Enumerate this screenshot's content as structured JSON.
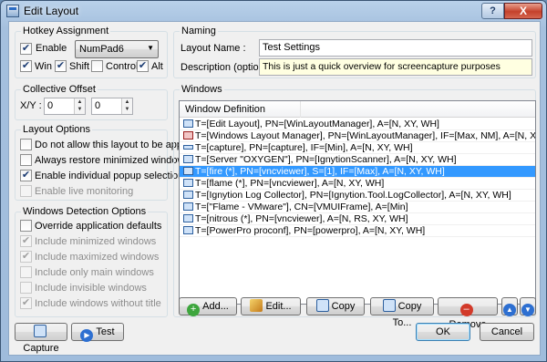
{
  "window": {
    "title": "Edit Layout",
    "help_glyph": "?",
    "close_glyph": "X"
  },
  "hotkey": {
    "group_title": "Hotkey Assignment",
    "enable_label": "Enable",
    "key_value": "NumPad6",
    "modifiers": [
      {
        "label": "Win",
        "checked": true
      },
      {
        "label": "Shift",
        "checked": true
      },
      {
        "label": "Control",
        "checked": false
      },
      {
        "label": "Alt",
        "checked": true
      }
    ]
  },
  "offset": {
    "group_title": "Collective Offset",
    "xy_label": "X/Y :",
    "x_value": "0",
    "y_value": "0"
  },
  "layout_options": {
    "group_title": "Layout Options",
    "items": [
      {
        "label": "Do not allow this layout to be applied",
        "checked": false,
        "enabled": true
      },
      {
        "label": "Always restore minimized windows",
        "checked": false,
        "enabled": true
      },
      {
        "label": "Enable individual popup selection",
        "checked": true,
        "enabled": true
      },
      {
        "label": "Enable live monitoring",
        "checked": false,
        "enabled": false
      }
    ]
  },
  "detection": {
    "group_title": "Windows Detection Options",
    "items": [
      {
        "label": "Override application defaults",
        "checked": false,
        "enabled": true
      },
      {
        "label": "Include minimized windows",
        "checked": true,
        "enabled": false
      },
      {
        "label": "Include maximized windows",
        "checked": true,
        "enabled": false
      },
      {
        "label": "Include only main windows",
        "checked": false,
        "enabled": false
      },
      {
        "label": "Include invisible windows",
        "checked": false,
        "enabled": false
      },
      {
        "label": "Include windows without title",
        "checked": true,
        "enabled": false
      }
    ]
  },
  "naming": {
    "group_title": "Naming",
    "layout_name_label": "Layout Name :",
    "layout_name_value": "Test Settings",
    "description_label": "Description (optional) :",
    "description_value": "This is just a quick overview for screencapture purposes"
  },
  "windows": {
    "group_title": "Windows",
    "column_header": "Window Definition",
    "rows": [
      {
        "text": "T=[Edit Layout], PN=[WinLayoutManager], A=[N, XY, WH]",
        "icon": "window-icon",
        "selected": false
      },
      {
        "text": "T=[Windows Layout Manager], PN=[WinLayoutManager], IF=[Max, NM], A=[N, XY, WH]",
        "icon": "app-red-icon",
        "selected": false
      },
      {
        "text": "T=[capture], PN=[capture], IF=[Min], A=[N, XY, WH]",
        "icon": "minimized-window-icon",
        "selected": false
      },
      {
        "text": "T=[Server \"OXYGEN\"], PN=[IgnytionScanner], A=[N, XY, WH]",
        "icon": "window-icon",
        "selected": false
      },
      {
        "text": "T=[fire (*], PN=[vncviewer], S=[1], IF=[Max], A=[N, XY, WH]",
        "icon": "window-icon",
        "selected": true
      },
      {
        "text": "T=[flame (*], PN=[vncviewer], A=[N, XY, WH]",
        "icon": "window-icon",
        "selected": false
      },
      {
        "text": "T=[Ignytion Log Collector], PN=[Ignytion.Tool.LogCollector], A=[N, XY, WH]",
        "icon": "window-icon",
        "selected": false
      },
      {
        "text": "T=[\"Flame - VMware\"], CN=[VMUIFrame], A=[Min]",
        "icon": "window-icon",
        "selected": false
      },
      {
        "text": "T=[nitrous (*], PN=[vncviewer], A=[N, RS, XY, WH]",
        "icon": "window-icon",
        "selected": false
      },
      {
        "text": "T=[PowerPro proconf], PN=[powerpro], A=[N, XY, WH]",
        "icon": "window-icon",
        "selected": false
      }
    ]
  },
  "actions": {
    "add": "Add...",
    "edit": "Edit...",
    "copy": "Copy",
    "copy_to": "Copy To...",
    "remove": "Remove"
  },
  "footer": {
    "capture": "Capture",
    "test": "Test",
    "ok": "OK",
    "cancel": "Cancel"
  },
  "colors": {
    "selection": "#3399ff",
    "description_bg": "#ffffe1",
    "add_icon": "#3ea63e",
    "remove_icon": "#d23a2a",
    "move_icon": "#2d6fd1"
  }
}
